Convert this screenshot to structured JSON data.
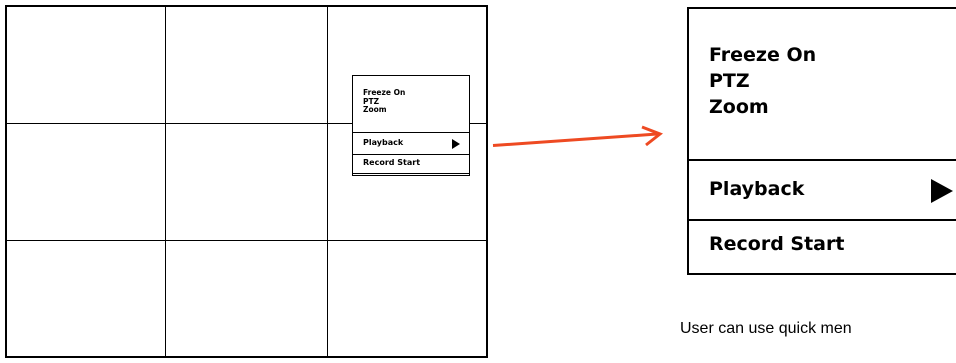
{
  "quick_menu_small": {
    "items": [
      "Freeze On",
      "PTZ",
      "Zoom"
    ],
    "playback_label": "Playback",
    "record_label": "Record Start"
  },
  "quick_menu_large": {
    "items": [
      "Freeze On",
      "PTZ",
      "Zoom"
    ],
    "playback_label": "Playback",
    "record_label": "Record Start"
  },
  "caption": "User can use quick men",
  "colors": {
    "arrow": "#ee4a22"
  },
  "icons": {
    "playback_submenu": "play-triangle-icon",
    "pointer": "arrow-right-icon"
  }
}
